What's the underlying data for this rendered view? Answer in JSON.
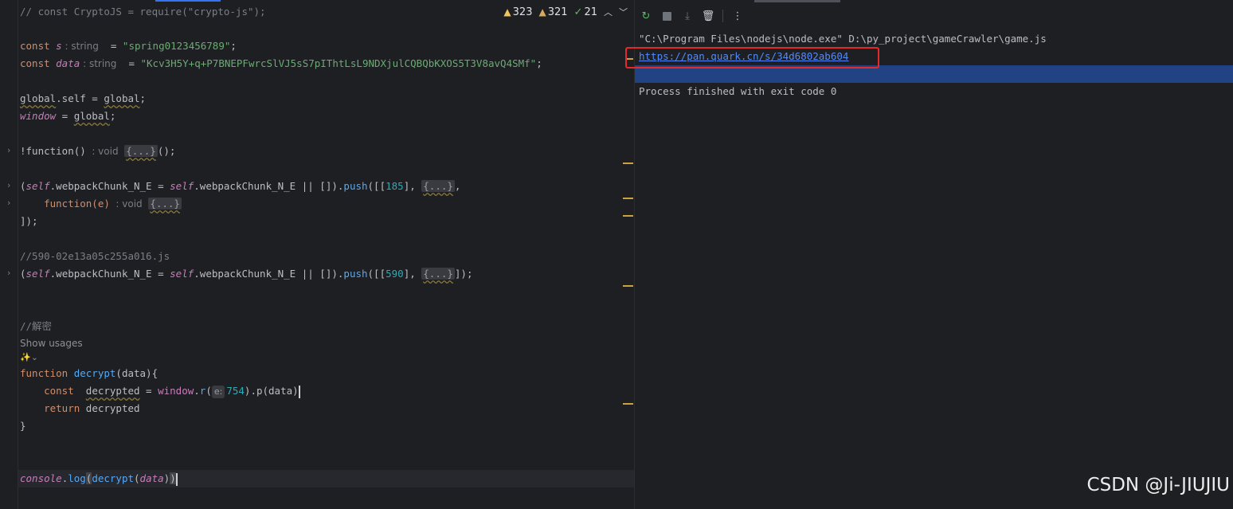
{
  "editor": {
    "inspections": {
      "warnings": "323",
      "weak_warnings": "321",
      "ok": "21"
    },
    "show_usages": "Show usages",
    "ai_icon": "✨⌄",
    "lines": {
      "l1": "// const CryptoJS = require(\"crypto-js\");",
      "s_kw": "const ",
      "s_name": "s",
      "s_hint": " : string",
      "s_eq": "  = ",
      "s_val": "\"spring0123456789\"",
      "semi": ";",
      "d_kw": "const ",
      "d_name": "data",
      "d_hint": " : string",
      "d_eq": "  = ",
      "d_val": "\"Kcv3H5Y+q+P7BNEPFwrcSlVJ5sS7pIThtLsL9NDXjulCQBQbKXOS5T3V8avQ4SMf\"",
      "g1_a": "global",
      "g1_b": ".self = ",
      "g1_c": "global",
      "g1_d": ";",
      "w_a": "window",
      "w_b": " = ",
      "w_c": "global",
      "w_d": ";",
      "f1_a": "!function() ",
      "f1_hint": ": void  ",
      "f1_box": "{...}",
      "f1_end": "();",
      "p1_open": "(",
      "p1_self": "self",
      "p1_mid": ".webpackChunk_N_E = ",
      "p1_self2": "self",
      "p1_mid2": ".webpackChunk_N_E || []).",
      "p1_push": "push",
      "p1_a": "([[",
      "p1_num": "185",
      "p1_b": "], ",
      "p1_box": "{...}",
      "p1_c": ",",
      "f2_a": "    function(e) ",
      "f2_hint": ": void  ",
      "f2_box": "{...}",
      "close1": "]);",
      "cm590": "//590-02e13a05c255a016.js",
      "p2_num": "590",
      "p2_end": "]);",
      "cm_decrypt": "//解密",
      "fn_kw": "function ",
      "fn_name": "decrypt",
      "fn_rest": "(data){",
      "c_kw": "    const  ",
      "c_var": "decrypted",
      "c_eq": " = ",
      "c_win": "window",
      "c_dot": ".",
      "c_r": "r",
      "c_paren": "(",
      "c_pill": "e:",
      "c_num": "754",
      "c_rest": ").p(data)",
      "ret_kw": "    return ",
      "ret_var": "decrypted",
      "close_brace": "}",
      "log_console": "console",
      "log_dot": ".",
      "log_fn": "log",
      "log_paren": "(",
      "log_dec": "decrypt",
      "log_p2": "(",
      "log_data": "data",
      "log_close": ")",
      "log_close2": ")"
    }
  },
  "run": {
    "toolbar": {
      "rerun": "↻",
      "scroll": "⤓",
      "clear": "🗑",
      "more": "⋮"
    },
    "cmd": "\"C:\\Program Files\\nodejs\\node.exe\" D:\\py_project\\gameCrawler\\game.js",
    "link": "https://pan.quark.cn/s/34d6802ab604",
    "exit": "Process finished with exit code 0"
  },
  "watermark": "CSDN @Ji-JIUJIU"
}
